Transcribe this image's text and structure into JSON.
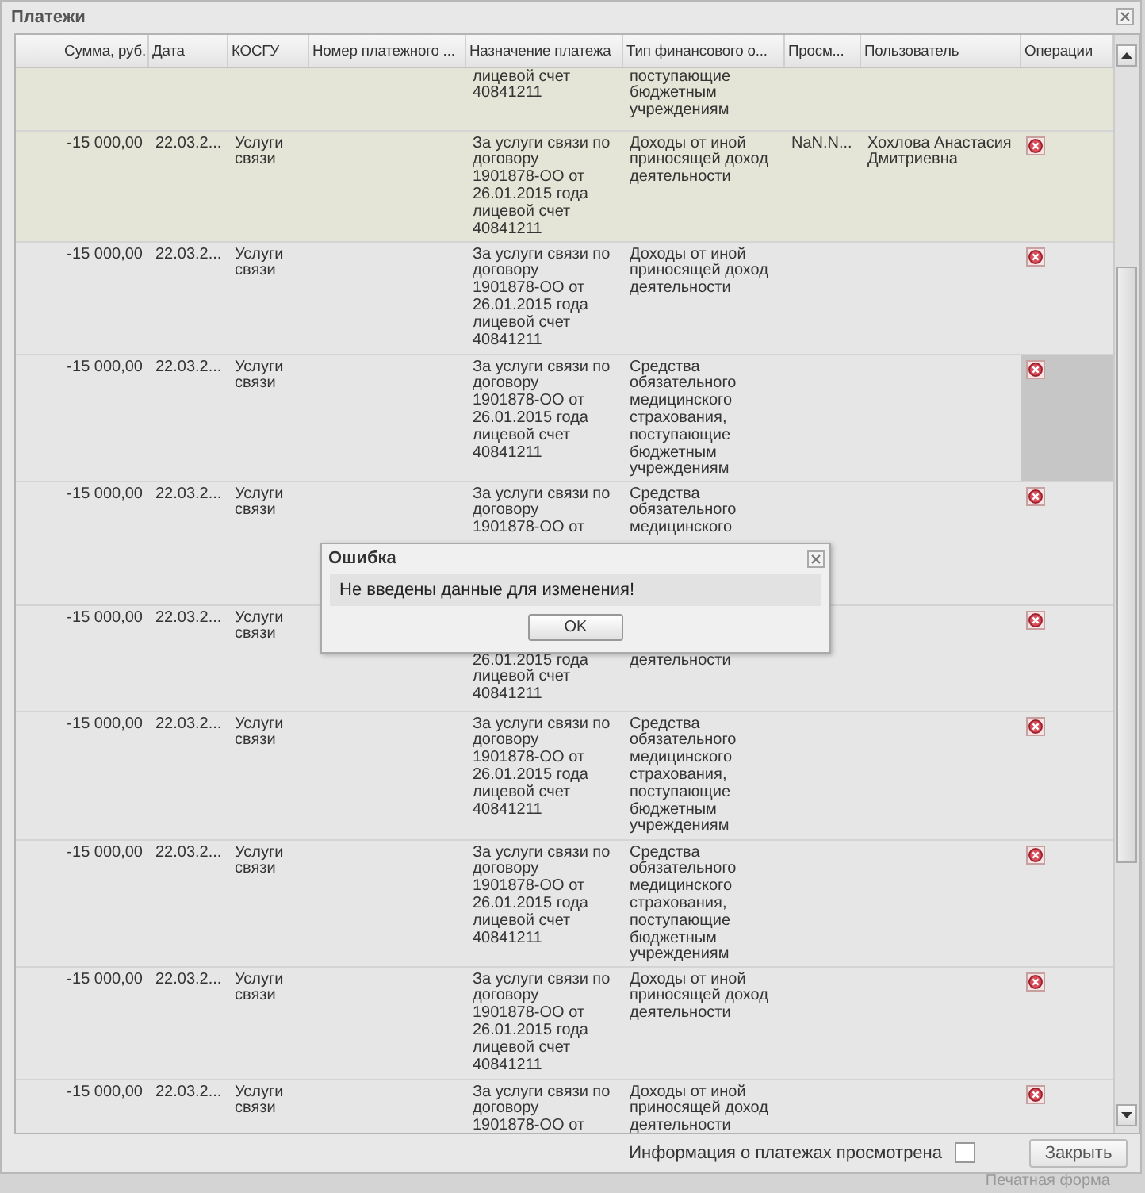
{
  "window": {
    "title": "Платежи"
  },
  "table": {
    "columns": [
      "Сумма, руб.",
      "Дата",
      "КОСГУ",
      "Номер платежного ...",
      "Назначение платежа",
      "Тип финансового о...",
      "Просм...",
      "Пользователь",
      "Операции"
    ],
    "rows": [
      {
        "selected": true,
        "operation_highlighted": false,
        "amount": "",
        "date": "",
        "kosgu": "",
        "number": "",
        "purpose": "лицевой счет\n40841211",
        "fund_type": "поступающие\nбюджетным\nучреждениям",
        "viewed": "",
        "user": "",
        "delete": false
      },
      {
        "selected": true,
        "operation_highlighted": false,
        "amount": "-15 000,00",
        "date": "22.03.2...",
        "kosgu": "Услуги\nсвязи",
        "number": "",
        "purpose": "За услуги связи по\nдоговору\n1901878-ОО от\n26.01.2015 года\nлицевой счет\n40841211",
        "fund_type": "Доходы от иной\nприносящей доход\nдеятельности",
        "viewed": "NaN.N...",
        "user": "Хохлова Анастасия\nДмитриевна",
        "delete": true
      },
      {
        "selected": false,
        "operation_highlighted": false,
        "amount": "-15 000,00",
        "date": "22.03.2...",
        "kosgu": "Услуги\nсвязи",
        "number": "",
        "purpose": "За услуги связи по\nдоговору\n1901878-ОО от\n26.01.2015 года\nлицевой счет\n40841211",
        "fund_type": "Доходы от иной\nприносящей доход\nдеятельности",
        "viewed": "",
        "user": "",
        "delete": true
      },
      {
        "selected": false,
        "operation_highlighted": true,
        "amount": "-15 000,00",
        "date": "22.03.2...",
        "kosgu": "Услуги\nсвязи",
        "number": "",
        "purpose": "За услуги связи по\nдоговору\n1901878-ОО от\n26.01.2015 года\nлицевой счет\n40841211",
        "fund_type": "Средства\nобязательного\nмедицинского\nстрахования,\nпоступающие\nбюджетным\nучреждениям",
        "viewed": "",
        "user": "",
        "delete": true
      },
      {
        "selected": false,
        "operation_highlighted": false,
        "amount": "-15 000,00",
        "date": "22.03.2...",
        "kosgu": "Услуги\nсвязи",
        "number": "",
        "purpose": "За услуги связи по\nдоговору\n1901878-ОО от",
        "fund_type": "Средства\nобязательного\nмедицинского",
        "viewed": "",
        "user": "",
        "delete": true
      },
      {
        "selected": false,
        "operation_highlighted": false,
        "amount": "-15 000,00",
        "date": "22.03.2...",
        "kosgu": "Услуги\nсвязи",
        "number": "",
        "purpose": "26.01.2015 года\nлицевой счет\n40841211",
        "fund_type": "деятельности",
        "viewed": "",
        "user": "",
        "delete": true,
        "covered_top": true
      },
      {
        "selected": false,
        "operation_highlighted": false,
        "amount": "-15 000,00",
        "date": "22.03.2...",
        "kosgu": "Услуги\nсвязи",
        "number": "",
        "purpose": "За услуги связи по\nдоговору\n1901878-ОО от\n26.01.2015 года\nлицевой счет\n40841211",
        "fund_type": "Средства\nобязательного\nмедицинского\nстрахования,\nпоступающие\nбюджетным\nучреждениям",
        "viewed": "",
        "user": "",
        "delete": true
      },
      {
        "selected": false,
        "operation_highlighted": false,
        "amount": "-15 000,00",
        "date": "22.03.2...",
        "kosgu": "Услуги\nсвязи",
        "number": "",
        "purpose": "За услуги связи по\nдоговору\n1901878-ОО от\n26.01.2015 года\nлицевой счет\n40841211",
        "fund_type": "Средства\nобязательного\nмедицинского\nстрахования,\nпоступающие\nбюджетным\nучреждениям",
        "viewed": "",
        "user": "",
        "delete": true
      },
      {
        "selected": false,
        "operation_highlighted": false,
        "amount": "-15 000,00",
        "date": "22.03.2...",
        "kosgu": "Услуги\nсвязи",
        "number": "",
        "purpose": "За услуги связи по\nдоговору\n1901878-ОО от\n26.01.2015 года\nлицевой счет\n40841211",
        "fund_type": "Доходы от иной\nприносящей доход\nдеятельности",
        "viewed": "",
        "user": "",
        "delete": true
      },
      {
        "selected": false,
        "operation_highlighted": false,
        "amount": "-15 000,00",
        "date": "22.03.2...",
        "kosgu": "Услуги\nсвязи",
        "number": "",
        "purpose": "За услуги связи по\nдоговору\n1901878-ОО от",
        "fund_type": "Доходы от иной\nприносящей доход\nдеятельности",
        "viewed": "",
        "user": "",
        "delete": true
      }
    ]
  },
  "footer": {
    "checkbox_label": "Информация о платежах просмотрена",
    "checked": false,
    "close_button": "Закрыть"
  },
  "background_link": "Печатная форма",
  "dialog": {
    "title": "Ошибка",
    "message": "Не введены данные для изменения!",
    "button": "OK"
  }
}
